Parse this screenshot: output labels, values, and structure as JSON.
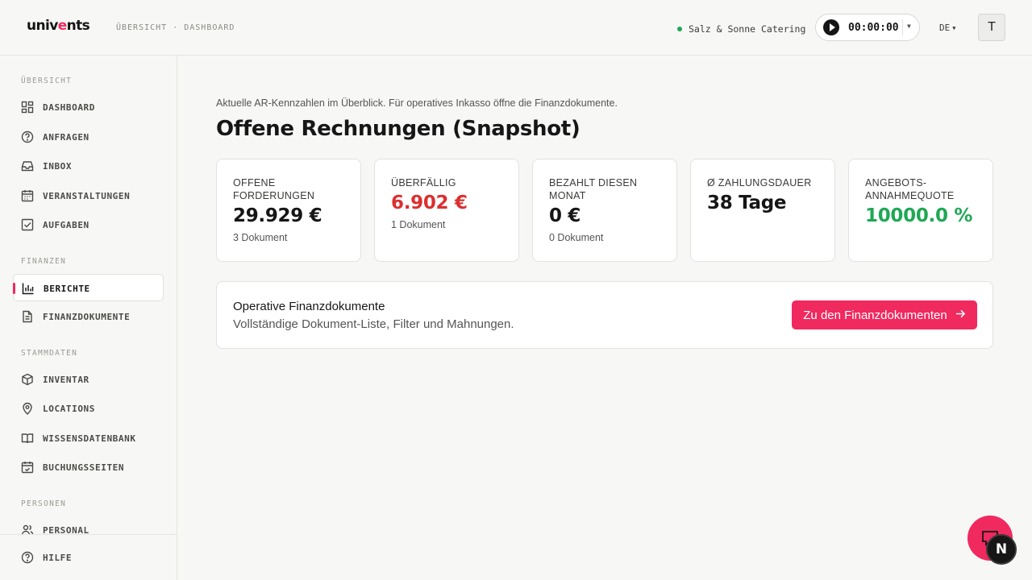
{
  "header": {
    "logo_pre": "univ",
    "logo_accent": "e",
    "logo_post": "nts",
    "breadcrumb": "ÜBERSICHT · DASHBOARD",
    "company": "Salz & Sonne Catering",
    "company_status_color": "#1fa855",
    "timer": "00:00:00",
    "language": "DE",
    "avatar_initial": "T"
  },
  "sidebar": {
    "sections": {
      "overview": "ÜBERSICHT",
      "finance": "FINANZEN",
      "master": "STAMMDATEN",
      "people": "PERSONEN"
    },
    "items": {
      "dashboard": "DASHBOARD",
      "anfragen": "ANFRAGEN",
      "inbox": "INBOX",
      "veranstaltungen": "VERANSTALTUNGEN",
      "aufgaben": "AUFGABEN",
      "berichte": "BERICHTE",
      "finanzdokumente": "FINANZDOKUMENTE",
      "inventar": "INVENTAR",
      "locations": "LOCATIONS",
      "wissensdatenbank": "WISSENSDATENBANK",
      "buchungsseiten": "BUCHUNGSSEITEN",
      "personal": "PERSONAL",
      "hilfe": "HILFE"
    },
    "active_item": "berichte"
  },
  "main": {
    "intro": "Aktuelle AR-Kennzahlen im Überblick. Für operatives Inkasso öffne die Finanzdokumente.",
    "title": "Offene Rechnungen (Snapshot)",
    "kpis": [
      {
        "label": "OFFENE FORDERUNGEN",
        "value": "29.929 €",
        "sub": "3 Dokument",
        "color": "#161616"
      },
      {
        "label": "ÜBERFÄLLIG",
        "value": "6.902 €",
        "sub": "1 Dokument",
        "color": "#dc2f2f"
      },
      {
        "label": "BEZAHLT DIESEN MONAT",
        "value": "0 €",
        "sub": "0 Dokument",
        "color": "#161616"
      },
      {
        "label": "Ø ZAHLUNGSDAUER",
        "value": "38 Tage",
        "sub": "",
        "color": "#161616"
      },
      {
        "label": "ANGEBOTS-ANNAHMEQUOTE",
        "value": "10000.0 %",
        "sub": "",
        "color": "#1fa855"
      }
    ],
    "operative": {
      "title": "Operative Finanzdokumente",
      "subtitle": "Vollständige Dokument-Liste, Filter und Mahnungen.",
      "button": "Zu den Finanzdokumenten",
      "button_color": "#f0295f"
    }
  },
  "widgets": {
    "n_badge": "N"
  }
}
